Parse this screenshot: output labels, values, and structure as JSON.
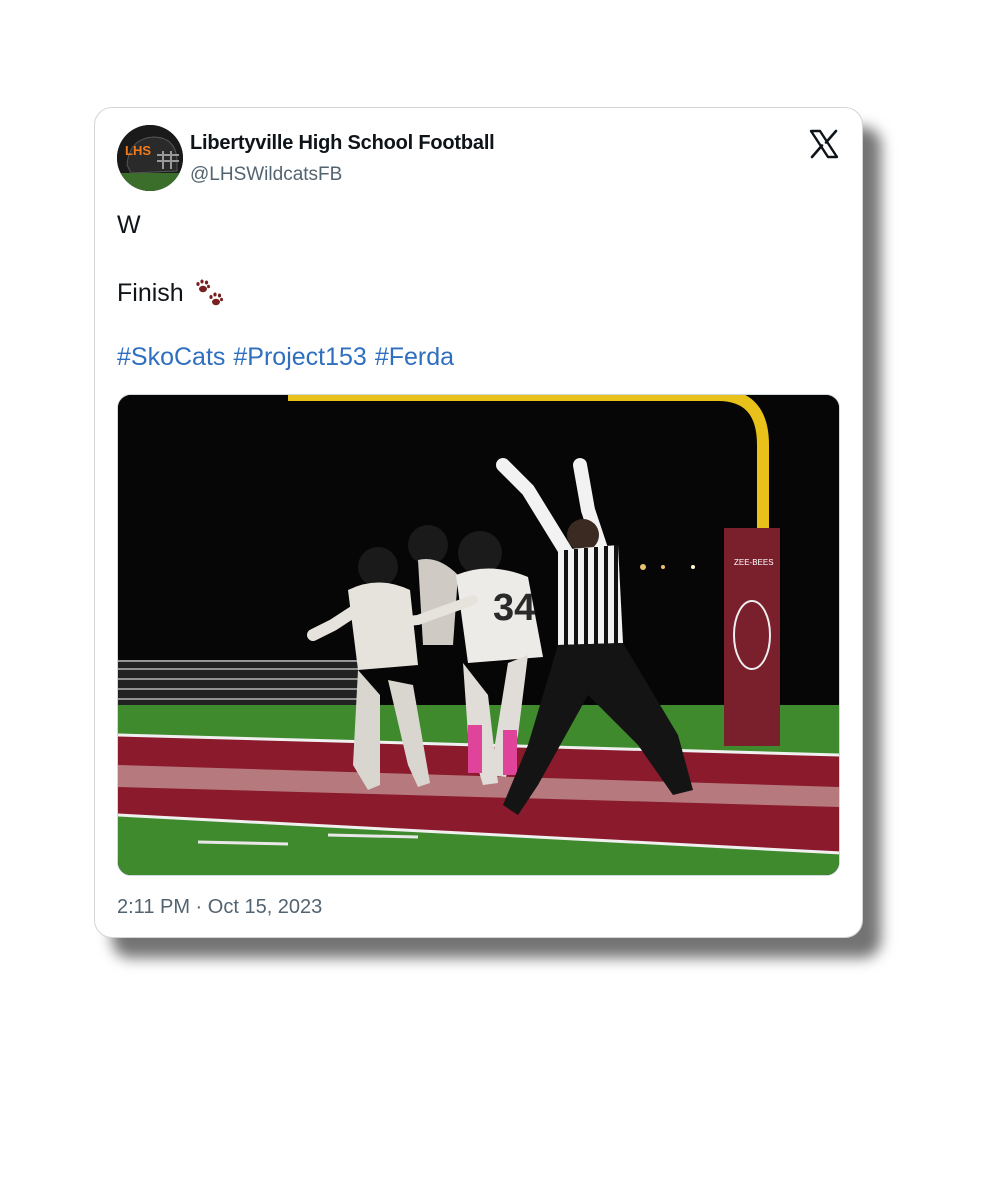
{
  "tweet": {
    "display_name": "Libertyville High School Football",
    "handle": "@LHSWildcatsFB",
    "text_line1": "W",
    "text_line2": "Finish",
    "emoji": "paw-prints",
    "hashtags": [
      "#SkoCats",
      "#Project153",
      "#Ferda"
    ],
    "timestamp": "2:11 PM · Oct 15, 2023",
    "avatar_text": "LHS",
    "photo": {
      "subject": "football players celebrating in end zone with referee signaling touchdown",
      "jersey_number": "34",
      "post_pad_text": "ZEE-BEES"
    }
  },
  "colors": {
    "hashtag": "#2f6fbf",
    "secondary_text": "#536471",
    "primary_text": "#0f1419",
    "paw": "#7a1f1f",
    "end_zone": "#8a1a2c",
    "turf": "#3f8a2c",
    "goal_post": "#e8c21a"
  },
  "icons": {
    "platform_logo": "x-logo-icon"
  }
}
